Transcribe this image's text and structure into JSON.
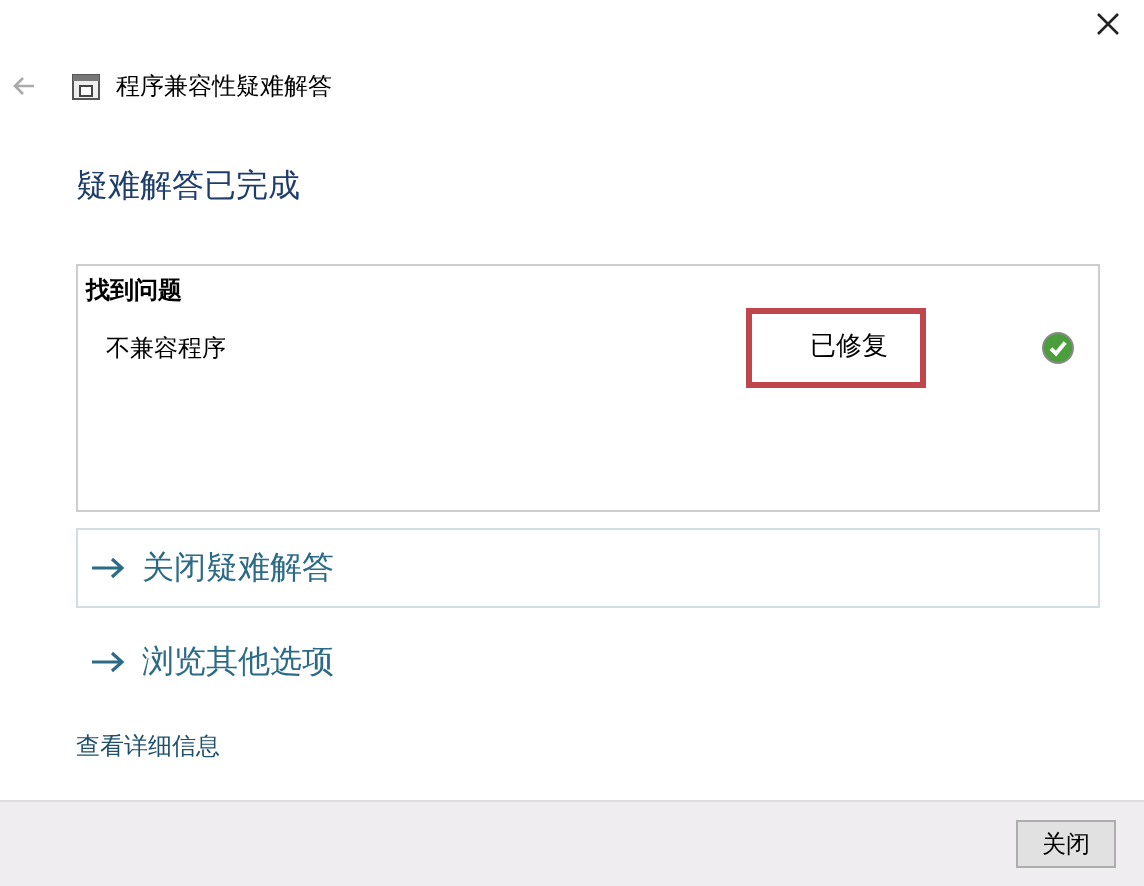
{
  "window": {
    "title": "程序兼容性疑难解答"
  },
  "heading": "疑难解答已完成",
  "results": {
    "title": "找到问题",
    "items": [
      {
        "problem": "不兼容程序",
        "status": "已修复",
        "highlighted": true,
        "fixed": true
      }
    ]
  },
  "actions": [
    {
      "label": "关闭疑难解答",
      "bordered": true
    },
    {
      "label": "浏览其他选项",
      "bordered": false
    }
  ],
  "details_link": "查看详细信息",
  "footer": {
    "buttons": [
      "关闭"
    ]
  }
}
